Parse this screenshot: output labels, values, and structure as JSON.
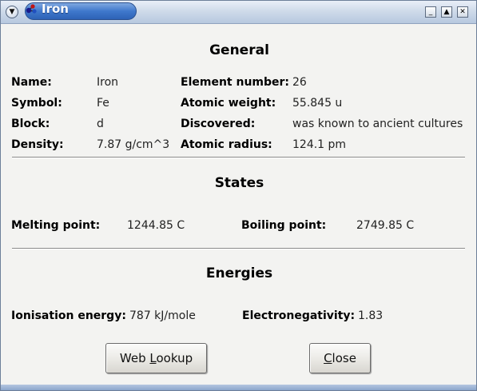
{
  "window": {
    "title": "Iron",
    "controls": {
      "minimize": "_",
      "maximize": "▲",
      "close": "✕"
    }
  },
  "sections": {
    "general": "General",
    "states": "States",
    "energies": "Energies"
  },
  "general": {
    "name_label": "Name:",
    "name_value": "Iron",
    "symbol_label": "Symbol:",
    "symbol_value": "Fe",
    "block_label": "Block:",
    "block_value": "d",
    "density_label": "Density:",
    "density_value": "7.87 g/cm^3",
    "element_number_label": "Element number:",
    "element_number_value": "26",
    "atomic_weight_label": "Atomic weight:",
    "atomic_weight_value": "55.845 u",
    "discovered_label": "Discovered:",
    "discovered_value": "was known to ancient cultures",
    "atomic_radius_label": "Atomic radius:",
    "atomic_radius_value": "124.1 pm"
  },
  "states": {
    "melting_label": "Melting point:",
    "melting_value": "1244.85 C",
    "boiling_label": "Boiling point:",
    "boiling_value": "2749.85 C"
  },
  "energies": {
    "ionisation_label": "Ionisation energy:",
    "ionisation_value": "787 kJ/mole",
    "electronegativity_label": "Electronegativity:",
    "electronegativity_value": "1.83"
  },
  "buttons": {
    "web_lookup_pre": "Web ",
    "web_lookup_mnemonic": "L",
    "web_lookup_post": "ookup",
    "close_mnemonic": "C",
    "close_post": "lose"
  },
  "icons": {
    "window_menu": "chevron-down-icon",
    "app": "molecule-icon"
  }
}
